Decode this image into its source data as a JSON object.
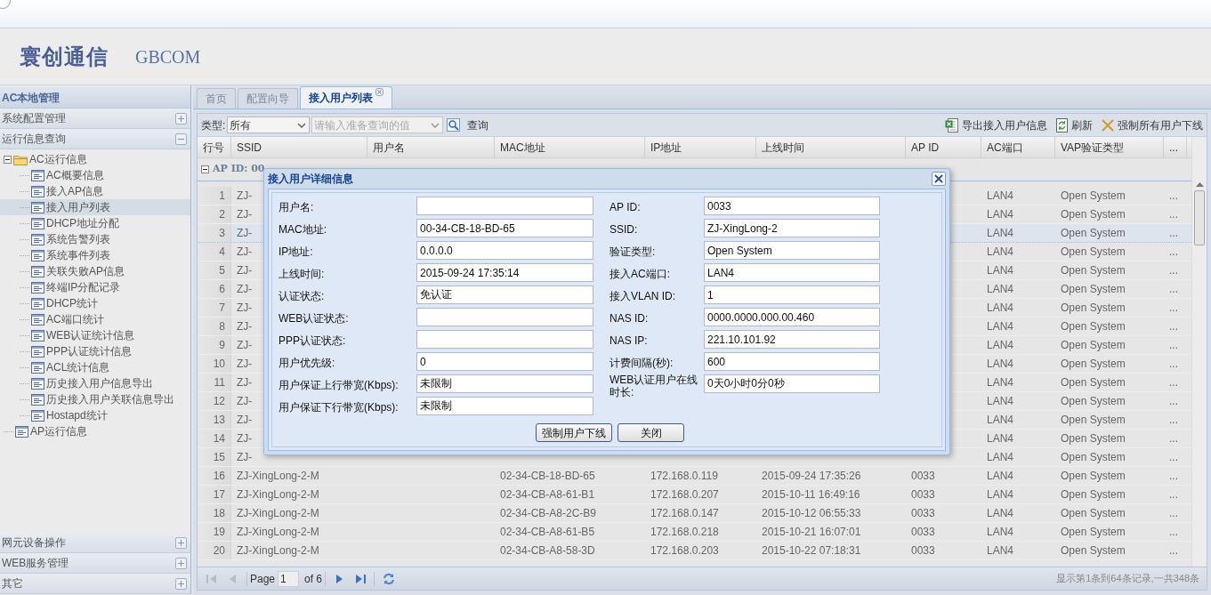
{
  "header": {
    "logo": "寰创通信",
    "brand": "GBCOM"
  },
  "sidebar": {
    "title": "AC本地管理",
    "top_sections": [
      {
        "label": "系统配置管理",
        "expanded": false
      },
      {
        "label": "运行信息查询",
        "expanded": true
      }
    ],
    "tree": [
      {
        "label": "AC运行信息",
        "kind": "folder",
        "expanded": true,
        "selected": false,
        "children": [
          {
            "label": "AC概要信息",
            "kind": "page",
            "selected": false
          },
          {
            "label": "接入AP信息",
            "kind": "page",
            "selected": false
          },
          {
            "label": "接入用户列表",
            "kind": "page",
            "selected": true
          },
          {
            "label": "DHCP地址分配",
            "kind": "page",
            "selected": false
          },
          {
            "label": "系统告警列表",
            "kind": "page",
            "selected": false
          },
          {
            "label": "系统事件列表",
            "kind": "page",
            "selected": false
          },
          {
            "label": "关联失败AP信息",
            "kind": "page",
            "selected": false
          },
          {
            "label": "终端IP分配记录",
            "kind": "page",
            "selected": false
          },
          {
            "label": "DHCP统计",
            "kind": "page",
            "selected": false
          },
          {
            "label": "AC端口统计",
            "kind": "page",
            "selected": false
          },
          {
            "label": "WEB认证统计信息",
            "kind": "page",
            "selected": false
          },
          {
            "label": "PPP认证统计信息",
            "kind": "page",
            "selected": false
          },
          {
            "label": "ACL统计信息",
            "kind": "page",
            "selected": false
          },
          {
            "label": "历史接入用户信息导出",
            "kind": "page",
            "selected": false
          },
          {
            "label": "历史接入用户关联信息导出",
            "kind": "page",
            "selected": false
          },
          {
            "label": "Hostapd统计",
            "kind": "page",
            "selected": false
          }
        ]
      },
      {
        "label": "AP运行信息",
        "kind": "page",
        "selected": false
      }
    ],
    "bottom_sections": [
      {
        "label": "网元设备操作",
        "expanded": false
      },
      {
        "label": "WEB服务管理",
        "expanded": false
      },
      {
        "label": "其它",
        "expanded": false
      }
    ]
  },
  "tabs": [
    {
      "label": "首页",
      "selected": false,
      "closable": false
    },
    {
      "label": "配置向导",
      "selected": false,
      "closable": false
    },
    {
      "label": "接入用户列表",
      "selected": true,
      "closable": true
    }
  ],
  "toolbar": {
    "type_label": "类型:",
    "type_value": "所有",
    "search_placeholder": "请输入准备查询的值",
    "search_button": "查询",
    "actions": [
      {
        "kind": "export",
        "label": "导出接入用户信息"
      },
      {
        "kind": "refresh",
        "label": "刷新"
      },
      {
        "kind": "force",
        "label": "强制所有用户下线"
      }
    ]
  },
  "table": {
    "columns": [
      "行号",
      "SSID",
      "用户名",
      "MAC地址",
      "IP地址",
      "上线时间",
      "AP ID",
      "AC端口",
      "VAP验证类型",
      "..."
    ],
    "group": "AP ID: 00",
    "rows": [
      {
        "number": "1",
        "ssid": "ZJ-",
        "ac_port": "LAN4",
        "vap_auth": "Open System",
        "more": "...",
        "selected": false
      },
      {
        "number": "2",
        "ssid": "ZJ-",
        "ac_port": "LAN4",
        "vap_auth": "Open System",
        "more": "...",
        "selected": false
      },
      {
        "number": "3",
        "ssid": "ZJ-",
        "ac_port": "LAN4",
        "vap_auth": "Open System",
        "more": "...",
        "selected": true
      },
      {
        "number": "4",
        "ssid": "ZJ-",
        "ac_port": "LAN4",
        "vap_auth": "Open System",
        "more": "...",
        "selected": false
      },
      {
        "number": "5",
        "ssid": "ZJ-",
        "ac_port": "LAN4",
        "vap_auth": "Open System",
        "more": "...",
        "selected": false
      },
      {
        "number": "6",
        "ssid": "ZJ-",
        "ac_port": "LAN4",
        "vap_auth": "Open System",
        "more": "...",
        "selected": false
      },
      {
        "number": "7",
        "ssid": "ZJ-",
        "ac_port": "LAN4",
        "vap_auth": "Open System",
        "more": "...",
        "selected": false
      },
      {
        "number": "8",
        "ssid": "ZJ-",
        "ac_port": "LAN4",
        "vap_auth": "Open System",
        "more": "...",
        "selected": false
      },
      {
        "number": "9",
        "ssid": "ZJ-",
        "ac_port": "LAN4",
        "vap_auth": "Open System",
        "more": "...",
        "selected": false
      },
      {
        "number": "10",
        "ssid": "ZJ-",
        "ac_port": "LAN4",
        "vap_auth": "Open System",
        "more": "...",
        "selected": false
      },
      {
        "number": "11",
        "ssid": "ZJ-",
        "ac_port": "LAN4",
        "vap_auth": "Open System",
        "more": "...",
        "selected": false
      },
      {
        "number": "12",
        "ssid": "ZJ-",
        "ac_port": "LAN4",
        "vap_auth": "Open System",
        "more": "...",
        "selected": false
      },
      {
        "number": "13",
        "ssid": "ZJ-",
        "ac_port": "LAN4",
        "vap_auth": "Open System",
        "more": "...",
        "selected": false
      },
      {
        "number": "14",
        "ssid": "ZJ-",
        "ac_port": "LAN4",
        "vap_auth": "Open System",
        "more": "...",
        "selected": false
      },
      {
        "number": "15",
        "ssid": "ZJ-",
        "ac_port": "LAN4",
        "vap_auth": "Open System",
        "more": "...",
        "selected": false
      },
      {
        "number": "16",
        "ssid": "ZJ-XingLong-2-M",
        "mac": "02-34-CB-18-BD-65",
        "ip": "172.168.0.119",
        "online_time": "2015-09-24 17:35:26",
        "ap_id": "0033",
        "ac_port": "LAN4",
        "vap_auth": "Open System",
        "more": "...",
        "selected": false
      },
      {
        "number": "17",
        "ssid": "ZJ-XingLong-2-M",
        "mac": "02-34-CB-A8-61-B1",
        "ip": "172.168.0.207",
        "online_time": "2015-10-11 16:49:16",
        "ap_id": "0033",
        "ac_port": "LAN4",
        "vap_auth": "Open System",
        "more": "...",
        "selected": false
      },
      {
        "number": "18",
        "ssid": "ZJ-XingLong-2-M",
        "mac": "02-34-CB-A8-2C-B9",
        "ip": "172.168.0.147",
        "online_time": "2015-10-12 06:55:33",
        "ap_id": "0033",
        "ac_port": "LAN4",
        "vap_auth": "Open System",
        "more": "...",
        "selected": false
      },
      {
        "number": "19",
        "ssid": "ZJ-XingLong-2-M",
        "mac": "02-34-CB-A8-61-B5",
        "ip": "172.168.0.218",
        "online_time": "2015-10-21 16:07:01",
        "ap_id": "0033",
        "ac_port": "LAN4",
        "vap_auth": "Open System",
        "more": "...",
        "selected": false
      },
      {
        "number": "20",
        "ssid": "ZJ-XingLong-2-M",
        "mac": "02-34-CB-A8-58-3D",
        "ip": "172.168.0.203",
        "online_time": "2015-10-22 07:18:31",
        "ap_id": "0033",
        "ac_port": "LAN4",
        "vap_auth": "Open System",
        "more": "...",
        "selected": false
      }
    ]
  },
  "paging": {
    "buttons": [
      {
        "kind": "first",
        "disabled": true
      },
      {
        "kind": "prev",
        "disabled": true
      },
      {
        "kind": "next",
        "disabled": false
      },
      {
        "kind": "last",
        "disabled": false
      }
    ],
    "page_label": "Page",
    "page_value": "1",
    "of_label": "of 6",
    "summary": "显示第1条到64条记录,一共348条"
  },
  "dialog": {
    "title": "接入用户详细信息",
    "left_fields": [
      {
        "label": "用户名:"
      },
      {
        "label": "MAC地址:",
        "value": "00-34-CB-18-BD-65"
      },
      {
        "label": "IP地址:",
        "value": "0.0.0.0"
      },
      {
        "label": "上线时间:",
        "value": "2015-09-24 17:35:14"
      },
      {
        "label": "认证状态:",
        "value": "免认证"
      },
      {
        "label": "WEB认证状态:"
      },
      {
        "label": "PPP认证状态:"
      },
      {
        "label": "用户优先级:",
        "value": "0"
      },
      {
        "label": "用户保证上行带宽(Kbps):",
        "value": "未限制"
      },
      {
        "label": "用户保证下行带宽(Kbps):",
        "value": "未限制"
      }
    ],
    "right_fields": [
      {
        "label": "AP ID:",
        "value": "0033"
      },
      {
        "label": "SSID:",
        "value": "ZJ-XingLong-2"
      },
      {
        "label": "验证类型:",
        "value": "Open System"
      },
      {
        "label": "接入AC端口:",
        "value": "LAN4"
      },
      {
        "label": "接入VLAN ID:",
        "value": "1"
      },
      {
        "label": "NAS ID:",
        "value": "0000.0000.000.00.460"
      },
      {
        "label": "NAS IP:",
        "value": "221.10.101.92"
      },
      {
        "label": "计费间隔(秒):",
        "value": "600"
      },
      {
        "label": "WEB认证用户在线时长:",
        "value": "0天0小时0分0秒"
      }
    ],
    "buttons": [
      "强制用户下线",
      "关闭"
    ]
  }
}
